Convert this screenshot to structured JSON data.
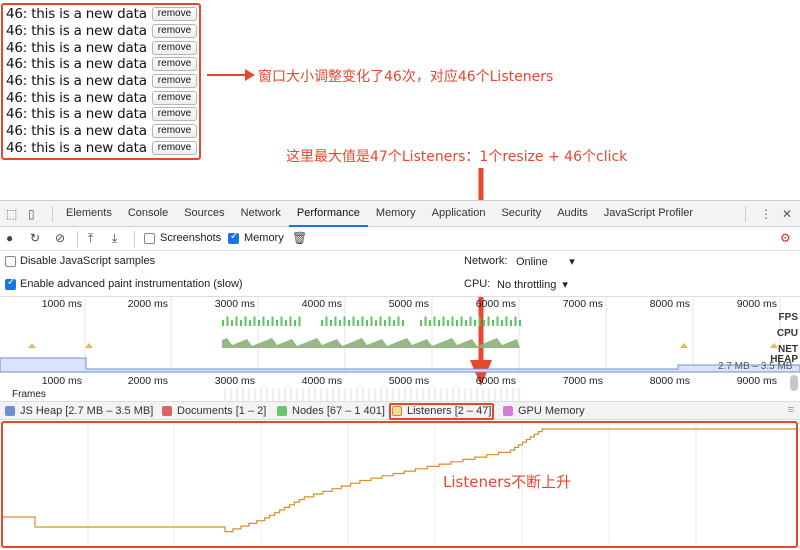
{
  "demo": {
    "rows": [
      {
        "text": "46: this is a new data",
        "button": "remove"
      },
      {
        "text": "46: this is a new data",
        "button": "remove"
      },
      {
        "text": "46: this is a new data",
        "button": "remove"
      },
      {
        "text": "46: this is a new data",
        "button": "remove"
      },
      {
        "text": "46: this is a new data",
        "button": "remove"
      },
      {
        "text": "46: this is a new data",
        "button": "remove"
      },
      {
        "text": "46: this is a new data",
        "button": "remove"
      },
      {
        "text": "46: this is a new data",
        "button": "remove"
      },
      {
        "text": "46: this is a new data",
        "button": "remove"
      }
    ]
  },
  "annotations": {
    "resize_note": "窗口大小调整变化了46次，对应46个Listeners",
    "max_note": "这里最大值是47个Listeners：1个resize +  46个click",
    "rise_note": "Listeners不断上升",
    "accent_color": "#e8472e"
  },
  "devtools": {
    "tabs": [
      "Elements",
      "Console",
      "Sources",
      "Network",
      "Performance",
      "Memory",
      "Application",
      "Security",
      "Audits",
      "JavaScript Profiler"
    ],
    "active_tab": "Performance",
    "toolbar": {
      "screenshots_label": "Screenshots",
      "screenshots_checked": false,
      "memory_label": "Memory",
      "memory_checked": true
    },
    "settings": {
      "disable_js_samples": "Disable JavaScript samples",
      "enable_paint": "Enable advanced paint instrumentation (slow)",
      "network_label": "Network:",
      "network_value": "Online",
      "cpu_label": "CPU:",
      "cpu_value": "No throttling"
    },
    "overview": {
      "ticks": [
        "1000 ms",
        "2000 ms",
        "3000 ms",
        "4000 ms",
        "5000 ms",
        "6000 ms",
        "7000 ms",
        "8000 ms",
        "9000 ms"
      ],
      "lane_labels": {
        "fps": "FPS",
        "cpu": "CPU",
        "net": "NET",
        "heap": "HEAP"
      },
      "heap_range": "2.7 MB – 3.5 MB",
      "frames_label": "Frames"
    },
    "legend": [
      {
        "label": "JS Heap [2.7 MB – 3.5 MB]",
        "color": "#6d8fd6",
        "checked": true
      },
      {
        "label": "Documents [1 – 2]",
        "color": "#d96464",
        "checked": true
      },
      {
        "label": "Nodes [67 – 1 401]",
        "color": "#6cc46c",
        "checked": true
      },
      {
        "label": "Listeners [2 – 47]",
        "color": "#e0a030",
        "checked": true
      },
      {
        "label": "GPU Memory",
        "color": "#d17bd1",
        "checked": true
      }
    ]
  },
  "chart_data": {
    "type": "line",
    "series": [
      {
        "name": "Listeners [2 – 47]",
        "values": []
      }
    ],
    "x": [
      0,
      0.04,
      0.27,
      0.33,
      0.38,
      0.45,
      0.52,
      0.58,
      0.64,
      0.68,
      0.79,
      1.0
    ],
    "y": [
      2,
      2,
      2,
      9,
      18,
      25,
      30,
      34,
      38,
      47,
      47,
      47
    ],
    "ylim": [
      0,
      47
    ],
    "color": "#d4902a"
  }
}
